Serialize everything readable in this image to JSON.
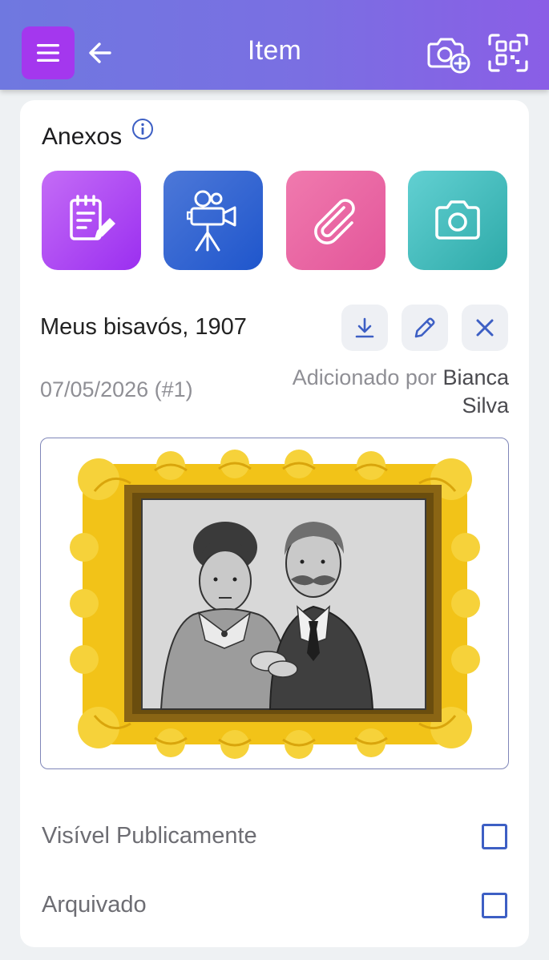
{
  "header": {
    "title": "Item",
    "menu_icon": "hamburger-icon",
    "back_icon": "arrow-left-icon",
    "camera_add_icon": "camera-add-icon",
    "qr_icon": "qr-scan-icon",
    "gradient_start": "#6f78e0",
    "gradient_end": "#8a5ee6",
    "menu_button_color": "#a437ee"
  },
  "attachments": {
    "title": "Anexos",
    "info_icon": "info-icon",
    "tiles": [
      {
        "icon": "note-edit-icon",
        "color": "#a437ee"
      },
      {
        "icon": "film-camera-icon",
        "color": "#2d62d0"
      },
      {
        "icon": "paperclip-icon",
        "color": "#e8619f"
      },
      {
        "icon": "camera-icon",
        "color": "#3cb4b3"
      }
    ]
  },
  "file": {
    "name": "Meus bisavós, 1907",
    "date": "07/05/2026 (#1)",
    "added_by_prefix": "Adicionado por",
    "author": "Bianca Silva",
    "actions": [
      "download-icon",
      "pencil-icon",
      "close-icon"
    ]
  },
  "options": {
    "public_label": "Visível Publicamente",
    "public_checked": false,
    "archived_label": "Arquivado",
    "archived_checked": false
  }
}
